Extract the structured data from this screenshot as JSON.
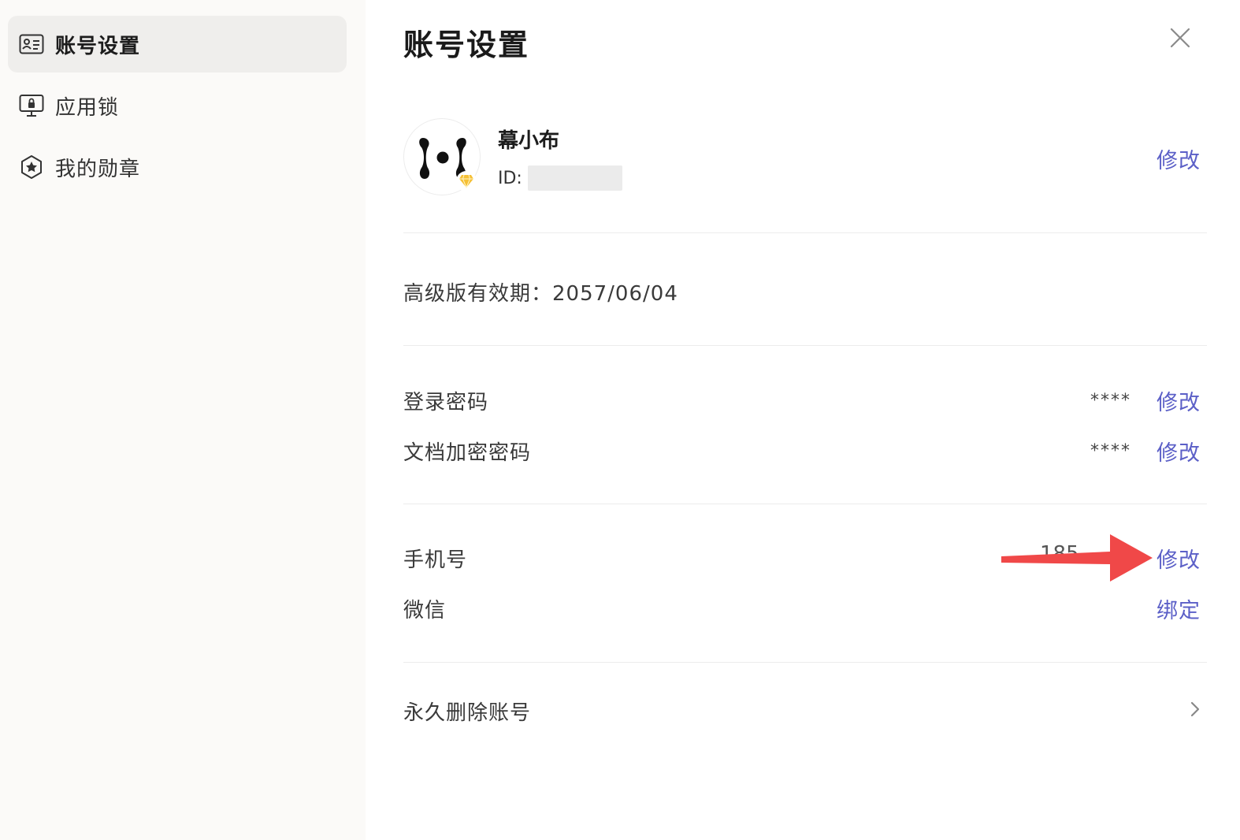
{
  "sidebar": {
    "items": [
      {
        "label": "账号设置",
        "icon": "id-card-icon",
        "active": true
      },
      {
        "label": "应用锁",
        "icon": "monitor-lock-icon",
        "active": false
      },
      {
        "label": "我的勋章",
        "icon": "star-hexagon-icon",
        "active": false
      }
    ]
  },
  "header": {
    "title": "账号设置",
    "close_icon": "close-icon"
  },
  "profile": {
    "name": "幕小布",
    "id_label": "ID:",
    "edit_label": "修改",
    "badge_icon": "diamond-icon"
  },
  "premium": {
    "text": "高级版有效期：2057/06/04"
  },
  "security": {
    "login_password": {
      "label": "登录密码",
      "value": "****",
      "action": "修改"
    },
    "doc_password": {
      "label": "文档加密密码",
      "value": "****",
      "action": "修改"
    }
  },
  "binding": {
    "phone": {
      "label": "手机号",
      "value": "185",
      "action": "修改"
    },
    "wechat": {
      "label": "微信",
      "action": "绑定"
    }
  },
  "danger": {
    "delete_label": "永久删除账号"
  },
  "colors": {
    "accent": "#5b5fc7",
    "sidebar_bg": "#fbfaf8",
    "active_item_bg": "#efeeec",
    "annotation_red": "#f04848",
    "badge_gold": "#f5c036"
  }
}
